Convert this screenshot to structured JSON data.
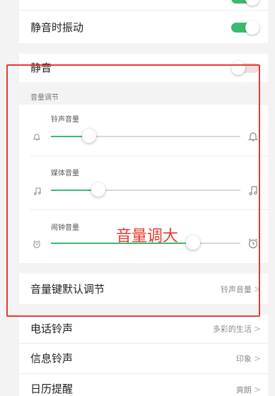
{
  "settings": {
    "vibrate_on_silent": {
      "label": "静音时振动",
      "on": true
    },
    "silent": {
      "label": "静音",
      "on": false
    }
  },
  "volume": {
    "header": "音量调节",
    "sliders": [
      {
        "title": "铃声音量",
        "level": 0.2,
        "icon_left": "bell-icon",
        "icon_right": "bell-icon"
      },
      {
        "title": "媒体音量",
        "level": 0.25,
        "icon_left": "music-note-icon",
        "icon_right": "music-note-icon"
      },
      {
        "title": "闹钟音量",
        "level": 0.75,
        "icon_left": "alarm-clock-icon",
        "icon_right": "alarm-clock-icon"
      }
    ]
  },
  "volume_key": {
    "label": "音量键默认调节",
    "value": "铃声音量"
  },
  "ringtone": {
    "label": "电话铃声",
    "value": "多彩的生活"
  },
  "message_tone": {
    "label": "信息铃声",
    "value": "印象"
  },
  "calendar_reminder": {
    "label": "日历提醒",
    "value": "爽朗"
  },
  "annotation": {
    "text": "音量调大"
  },
  "colors": {
    "accent": "#3cb96e",
    "annotation": "#e63a2e",
    "toggle_off": "#ececec"
  }
}
